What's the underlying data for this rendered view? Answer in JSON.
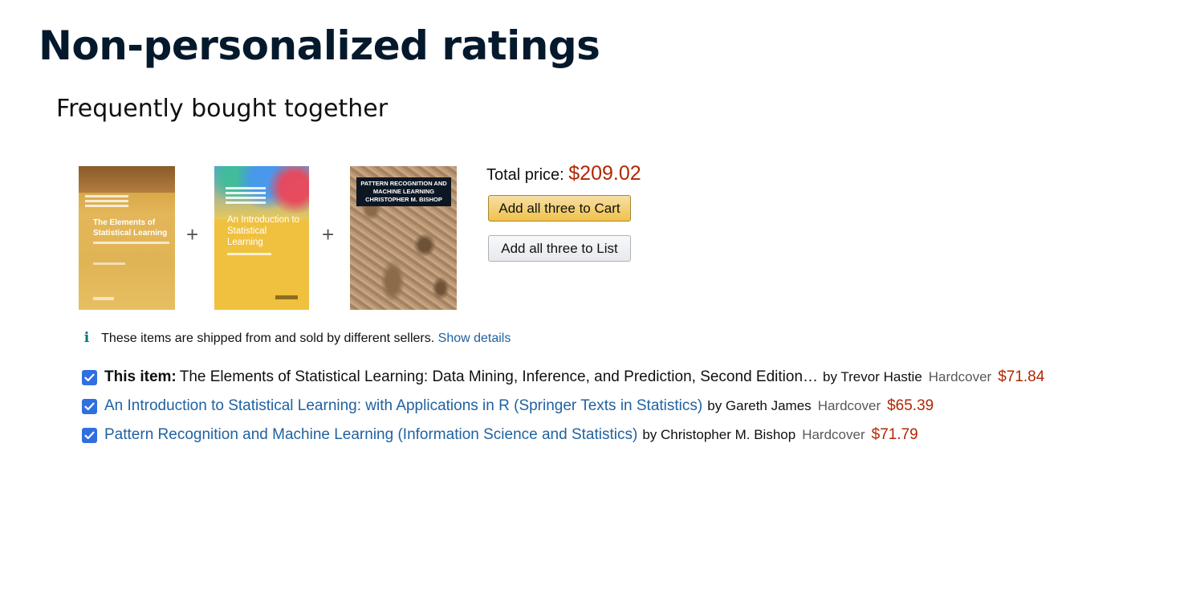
{
  "slide": {
    "title": "Non-personalized ratings",
    "subtitle": "Frequently bought together"
  },
  "bundle": {
    "books": [
      {
        "cover_title": "The Elements of Statistical Learning",
        "cover_colors": [
          "#a8733a",
          "#e0b455"
        ]
      },
      {
        "cover_title": "An Introduction to Statistical Learning",
        "cover_colors": [
          "#5aa0d8",
          "#f0c13e"
        ]
      },
      {
        "cover_title": "PATTERN RECOGNITION AND MACHINE LEARNING",
        "cover_author": "CHRISTOPHER M. BISHOP",
        "cover_colors": [
          "#0d1724",
          "#b5916c"
        ]
      }
    ],
    "plus_symbol": "+",
    "total_label": "Total price:",
    "total_amount": "$209.02",
    "add_to_cart_label": "Add all three to Cart",
    "add_to_list_label": "Add all three to List"
  },
  "notice": {
    "icon": "info-icon",
    "icon_glyph": "i",
    "text": "These items are shipped from and sold by different sellers.",
    "link": "Show details"
  },
  "items": [
    {
      "checked": true,
      "prefix": "This item:",
      "title": "The Elements of Statistical Learning: Data Mining, Inference, and Prediction, Second Edition…",
      "byline": "by Trevor Hastie",
      "format": "Hardcover",
      "price": "$71.84"
    },
    {
      "checked": true,
      "title": "An Introduction to Statistical Learning: with Applications in R (Springer Texts in Statistics)",
      "byline": "by Gareth James",
      "format": "Hardcover",
      "price": "$65.39"
    },
    {
      "checked": true,
      "title": "Pattern Recognition and Machine Learning (Information Science and Statistics)",
      "byline": "by Christopher M. Bishop",
      "format": "Hardcover",
      "price": "$71.79"
    }
  ],
  "colors": {
    "title_navy": "#05192d",
    "price_red": "#b12704",
    "link_blue": "#2162a1",
    "checkbox_blue": "#2f6fe0",
    "cart_button_yellow": "#f0c14b",
    "list_button_gray": "#e7e9ec"
  }
}
